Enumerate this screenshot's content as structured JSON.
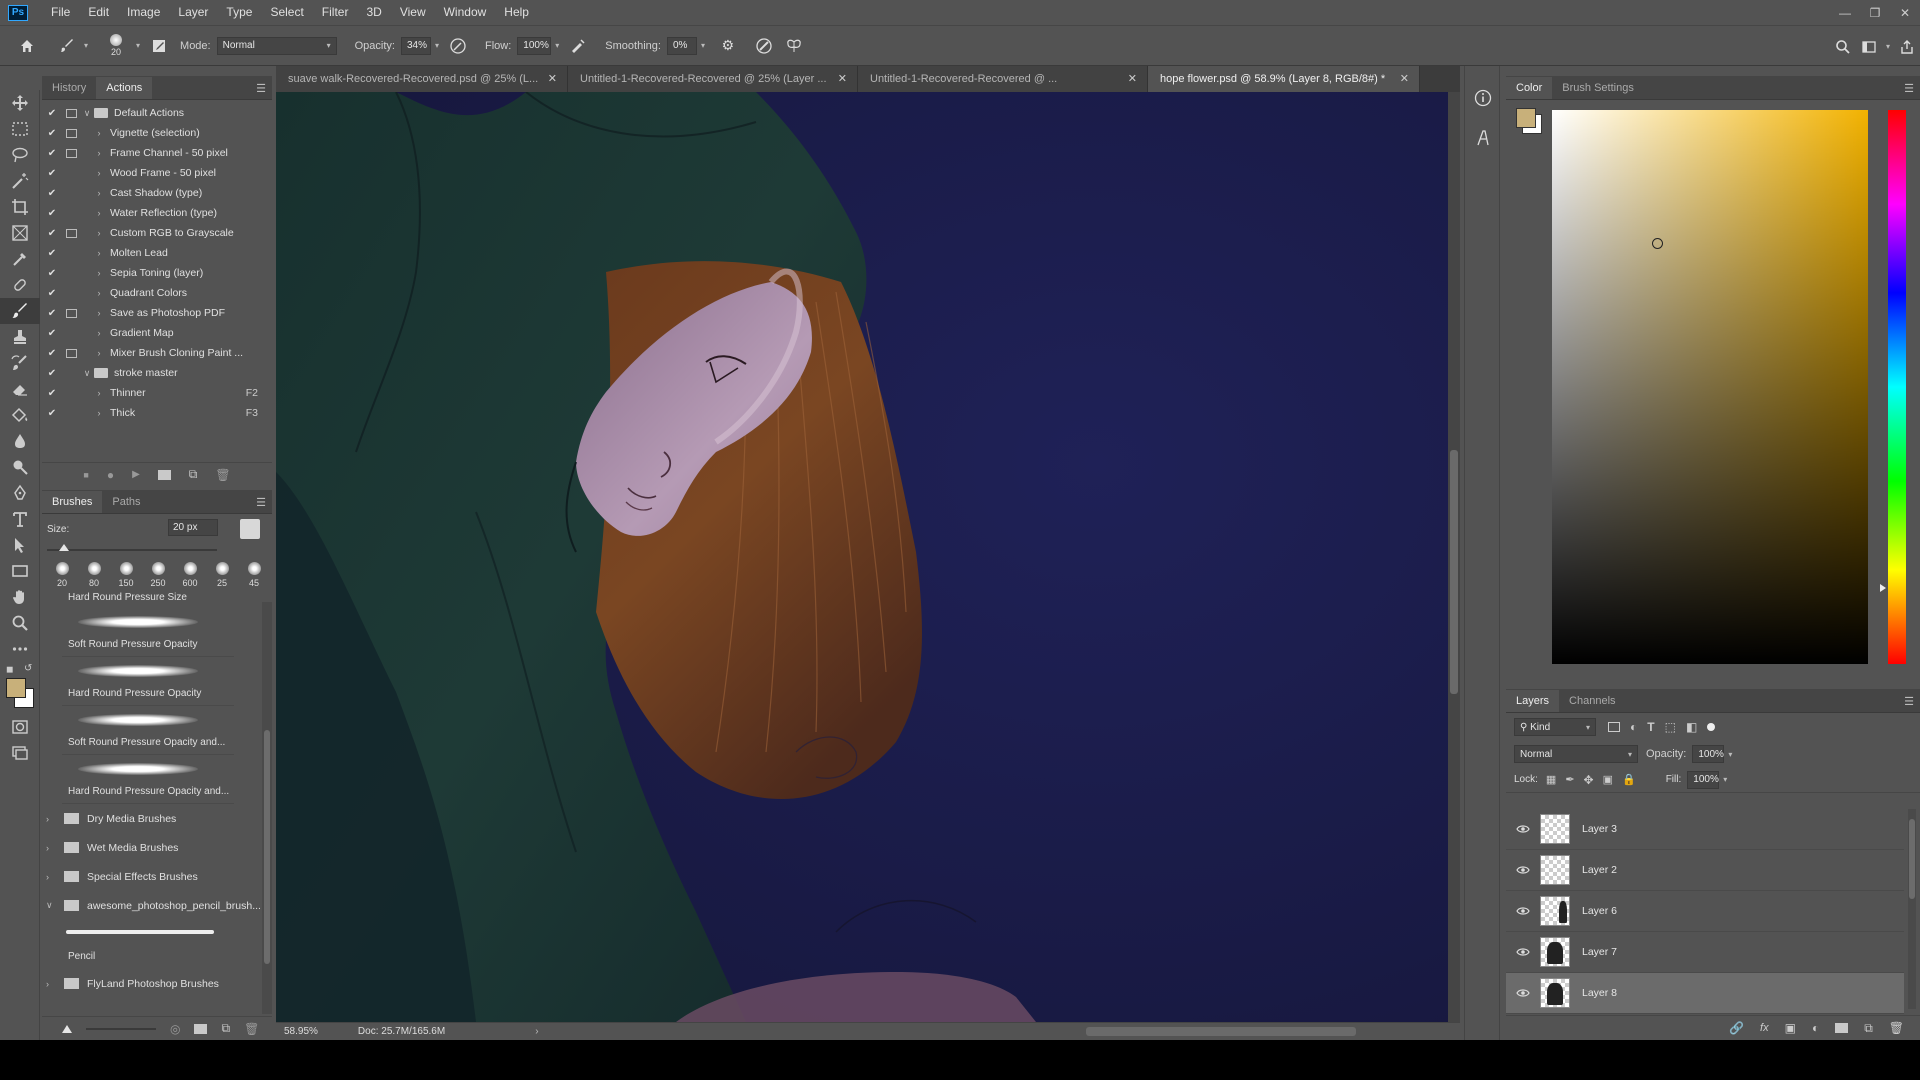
{
  "menu": [
    "File",
    "Edit",
    "Image",
    "Layer",
    "Type",
    "Select",
    "Filter",
    "3D",
    "View",
    "Window",
    "Help"
  ],
  "app_logo": "Ps",
  "options": {
    "brush_size": "20",
    "mode_label": "Mode:",
    "mode_value": "Normal",
    "opacity_label": "Opacity:",
    "opacity_value": "34%",
    "flow_label": "Flow:",
    "flow_value": "100%",
    "smoothing_label": "Smoothing:",
    "smoothing_value": "0%"
  },
  "history_panel": {
    "tabs": [
      "History",
      "Actions"
    ],
    "active_tab": "Actions",
    "actions": [
      {
        "label": "Default Actions",
        "type": "set",
        "dialog": true
      },
      {
        "label": "Vignette (selection)",
        "type": "action",
        "dialog": true
      },
      {
        "label": "Frame Channel - 50 pixel",
        "type": "action",
        "dialog": true
      },
      {
        "label": "Wood Frame - 50 pixel",
        "type": "action",
        "dialog": false
      },
      {
        "label": "Cast Shadow (type)",
        "type": "action",
        "dialog": false
      },
      {
        "label": "Water Reflection (type)",
        "type": "action",
        "dialog": false
      },
      {
        "label": "Custom RGB to Grayscale",
        "type": "action",
        "dialog": true
      },
      {
        "label": "Molten Lead",
        "type": "action",
        "dialog": false
      },
      {
        "label": "Sepia Toning (layer)",
        "type": "action",
        "dialog": false
      },
      {
        "label": "Quadrant Colors",
        "type": "action",
        "dialog": false
      },
      {
        "label": "Save as Photoshop PDF",
        "type": "action",
        "dialog": true
      },
      {
        "label": "Gradient Map",
        "type": "action",
        "dialog": false
      },
      {
        "label": "Mixer Brush Cloning Paint ...",
        "type": "action",
        "dialog": true
      },
      {
        "label": "stroke master",
        "type": "set",
        "dialog": false
      },
      {
        "label": "Thinner",
        "type": "action",
        "dialog": false,
        "key": "F2"
      },
      {
        "label": "Thick",
        "type": "action",
        "dialog": false,
        "key": "F3"
      }
    ]
  },
  "brushes_panel": {
    "tabs": [
      "Brushes",
      "Paths"
    ],
    "size_label": "Size:",
    "size_value": "20 px",
    "size_fraction": 0.1,
    "presets": [
      "20",
      "80",
      "150",
      "250",
      "600",
      "25",
      "45"
    ],
    "brush_items": [
      "Hard Round Pressure Size",
      "Soft Round Pressure Opacity",
      "Hard Round Pressure Opacity",
      "Soft Round Pressure Opacity and...",
      "Hard Round Pressure Opacity and..."
    ],
    "folders": [
      "Dry Media Brushes",
      "Wet Media Brushes",
      "Special Effects Brushes",
      "awesome_photoshop_pencil_brush..."
    ],
    "pencil_item": "Pencil",
    "last_folder": "FlyLand Photoshop Brushes"
  },
  "doc_tabs": [
    {
      "label": "suave walk-Recovered-Recovered.psd @ 25% (L...",
      "active": false
    },
    {
      "label": "Untitled-1-Recovered-Recovered @ 25% (Layer ...",
      "active": false
    },
    {
      "label": "Untitled-1-Recovered-Recovered @ ...",
      "active": false
    },
    {
      "label": "hope flower.psd @ 58.9% (Layer 8, RGB/8#) *",
      "active": true
    }
  ],
  "status": {
    "zoom": "58.95%",
    "doc": "Doc: 25.7M/165.6M"
  },
  "color_panel": {
    "tabs": [
      "Color",
      "Brush Settings"
    ],
    "foreground": "#c8b07a",
    "background": "#ffffff",
    "hue_color": "#f2b200"
  },
  "layers_panel": {
    "tabs": [
      "Layers",
      "Channels"
    ],
    "filter_kind": "Kind",
    "blend_mode": "Normal",
    "opacity_label": "Opacity:",
    "opacity_value": "100%",
    "lock_label": "Lock:",
    "fill_label": "Fill:",
    "fill_value": "100%",
    "layers": [
      {
        "name": "Layer 3",
        "selected": false
      },
      {
        "name": "Layer 2",
        "selected": false
      },
      {
        "name": "Layer 6",
        "selected": false
      },
      {
        "name": "Layer 7",
        "selected": false
      },
      {
        "name": "Layer 8",
        "selected": true
      }
    ]
  }
}
